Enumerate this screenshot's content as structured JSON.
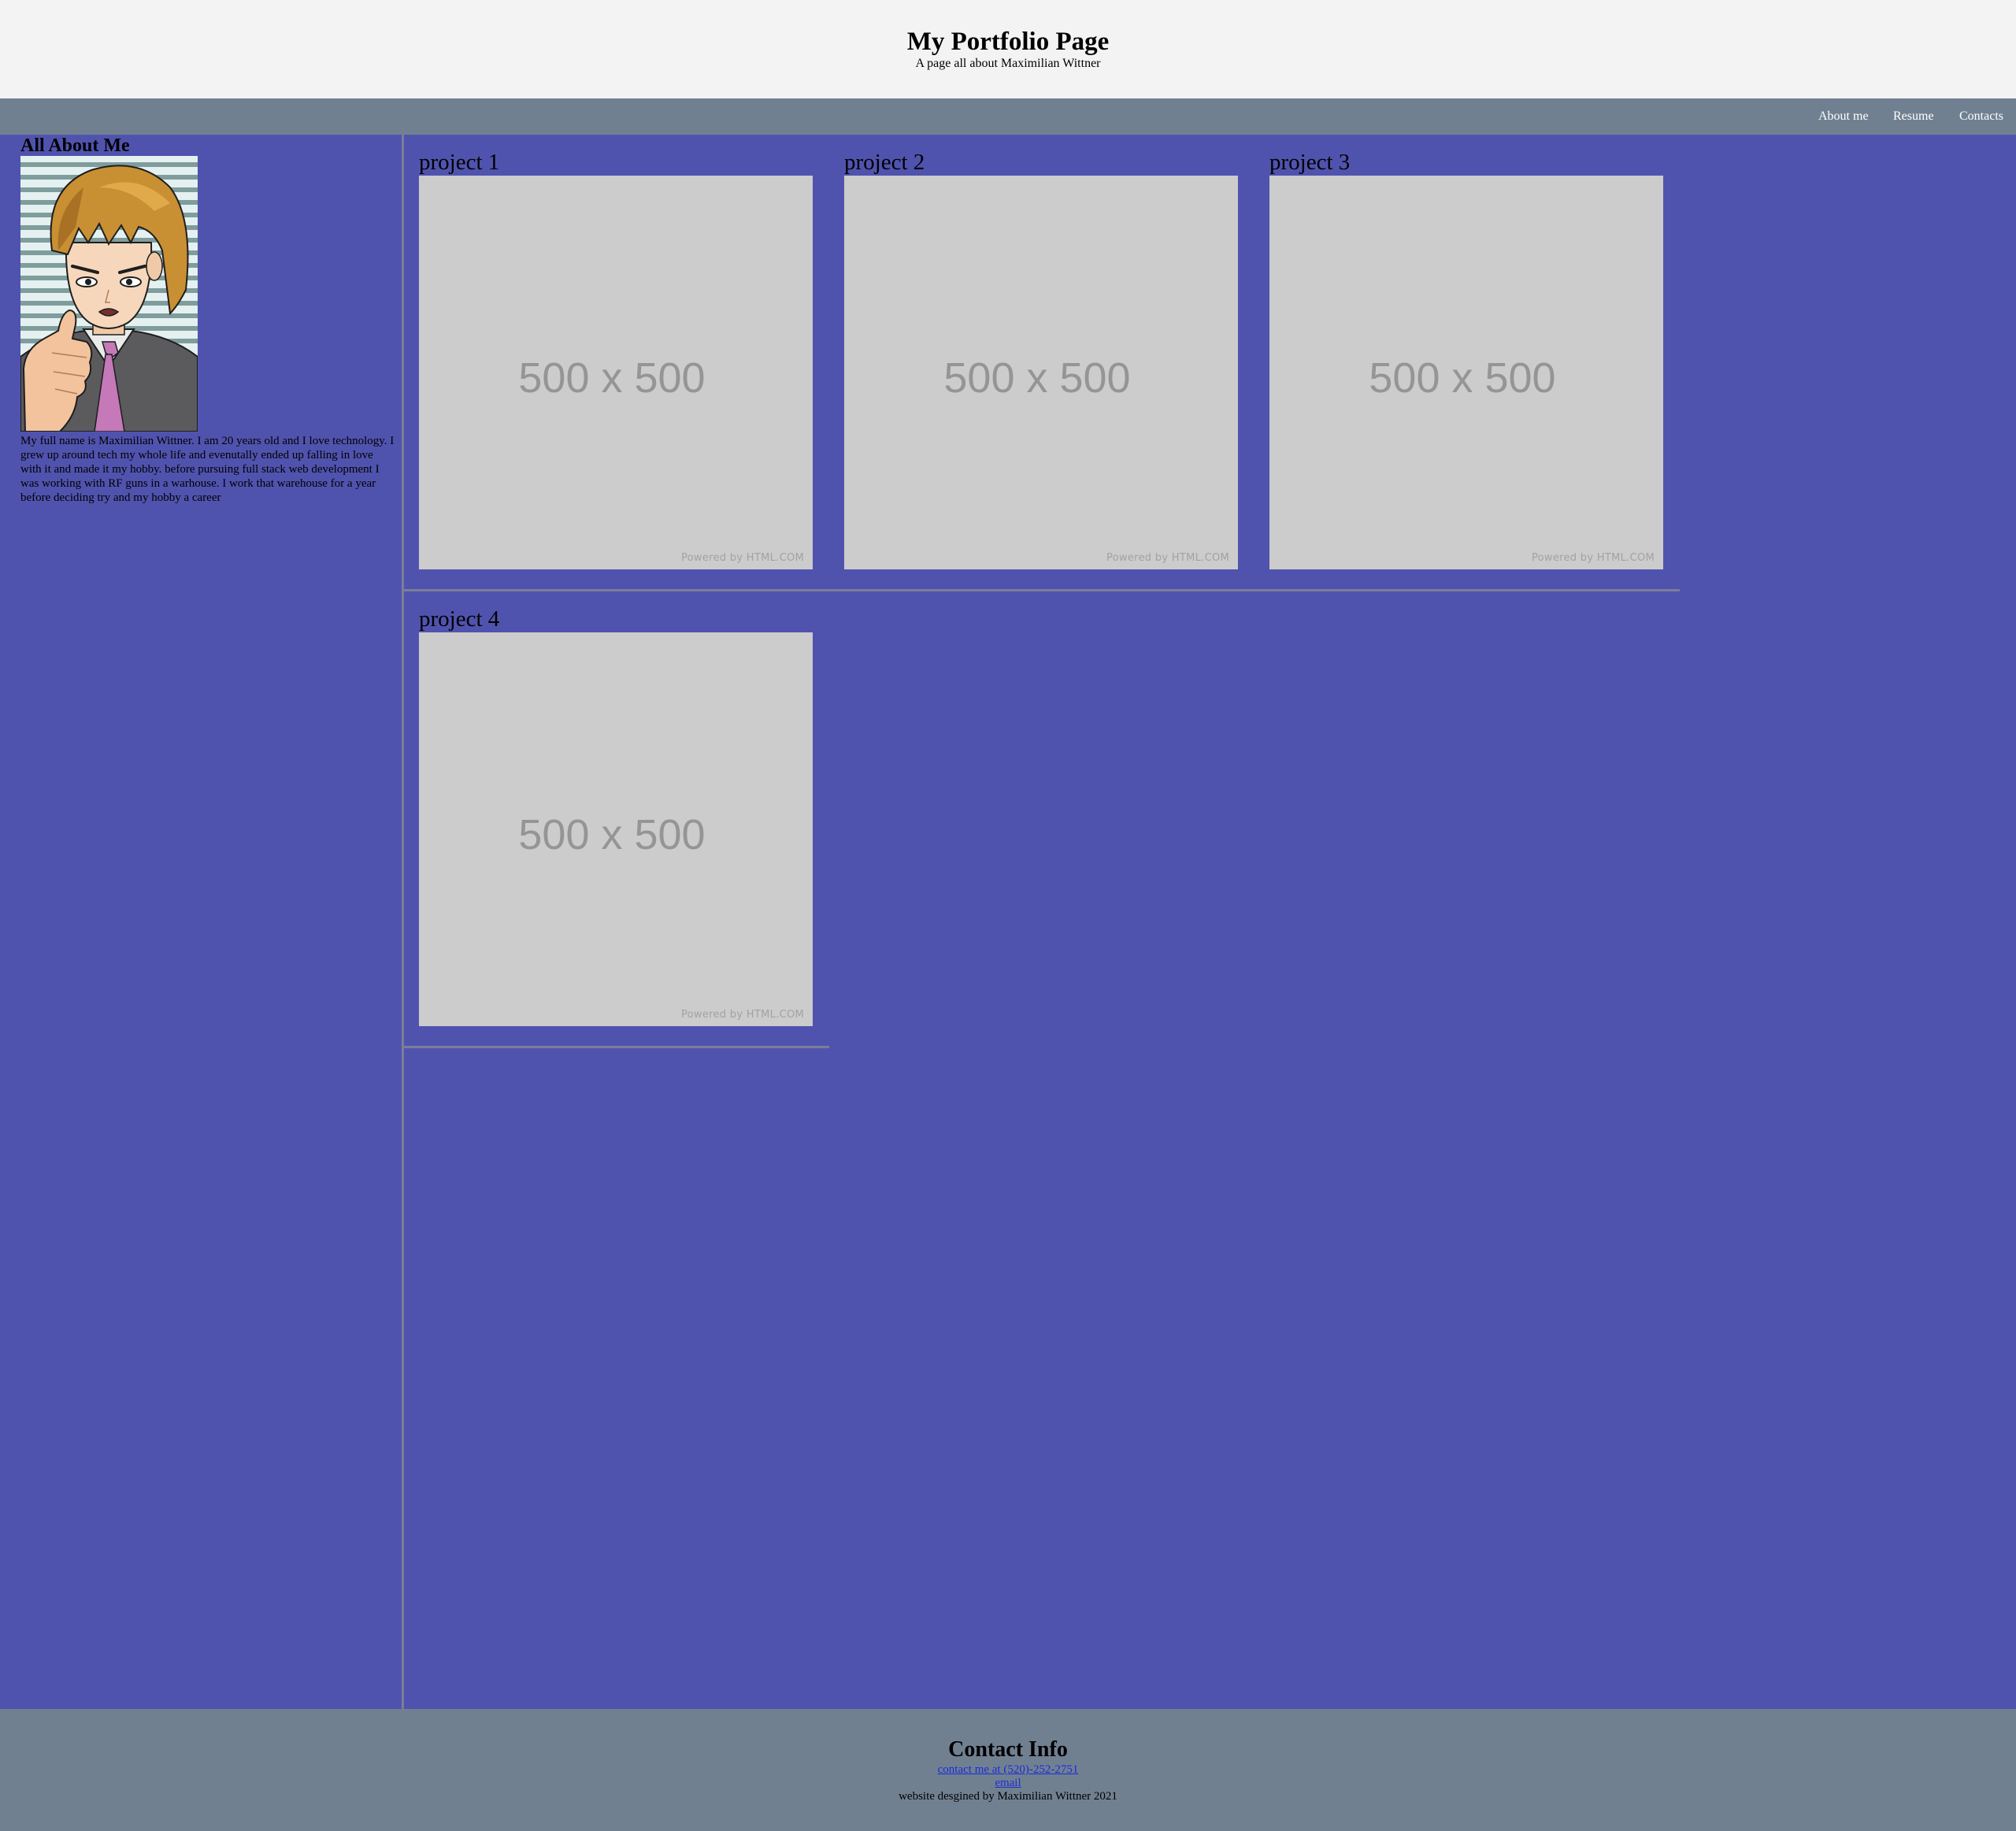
{
  "header": {
    "title": "My Portfolio Page",
    "subtitle": "A page all about Maximilian Wittner"
  },
  "nav": {
    "items": [
      {
        "label": "About me"
      },
      {
        "label": "Resume"
      },
      {
        "label": "Contacts"
      }
    ]
  },
  "sidebar": {
    "heading": "All About Me",
    "avatar_description": "anime-style-portrait",
    "bio": "My full name is Maximilian Wittner. I am 20 years old and I love technology. I grew up around tech my whole life and evenutally ended up falling in love with it and made it my hobby. before pursuing full stack web development I was working with RF guns in a warhouse. I work that warehouse for a year before deciding try and my hobby a career"
  },
  "projects": [
    {
      "title": "project 1",
      "placeholder_text": "500 x 500",
      "placeholder_credit": "Powered by HTML.COM"
    },
    {
      "title": "project 2",
      "placeholder_text": "500 x 500",
      "placeholder_credit": "Powered by HTML.COM"
    },
    {
      "title": "project 3",
      "placeholder_text": "500 x 500",
      "placeholder_credit": "Powered by HTML.COM"
    },
    {
      "title": "project 4",
      "placeholder_text": "500 x 500",
      "placeholder_credit": "Powered by HTML.COM"
    }
  ],
  "footer": {
    "heading": "Contact Info",
    "phone_link": "contact me at (520)-252-2751",
    "email_link": "email",
    "credit": "website desgined by Maximilian Wittner 2021"
  },
  "colors": {
    "page_background": "#5053ae",
    "header_background": "#f3f3f3",
    "nav_background": "#718091",
    "footer_background": "#718091",
    "placeholder_background": "#cccccc",
    "divider": "#7b7e99",
    "link": "#1a2bd8"
  }
}
